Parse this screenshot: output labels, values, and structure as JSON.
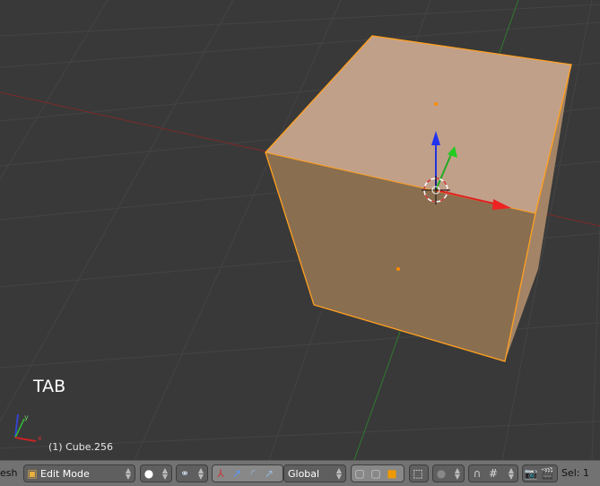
{
  "viewport": {
    "overlay_text": "TAB",
    "object_info": "(1) Cube.256",
    "colors": {
      "background": "#393939",
      "cube_top": "#c1a08a",
      "cube_front": "#8a6e50",
      "selection": "#ffa020",
      "x_axis": "#cc2222",
      "y_axis": "#22aa22",
      "z_axis": "#2233dd"
    }
  },
  "header": {
    "menu_partial": "esh",
    "mode": "Edit Mode",
    "orientation": "Global",
    "selection_count": "Sel: 1",
    "icons": [
      "mode-icon",
      "viewport-shading-icon",
      "pivot-icon",
      "manipulator-icon",
      "translate-icon",
      "rotate-icon",
      "scale-icon",
      "vertex-select-icon",
      "edge-select-icon",
      "face-select-icon",
      "occlude-icon",
      "proportional-edit-icon",
      "snap-icon",
      "snap-target-icon",
      "render-icon",
      "clapperboard-icon"
    ]
  }
}
